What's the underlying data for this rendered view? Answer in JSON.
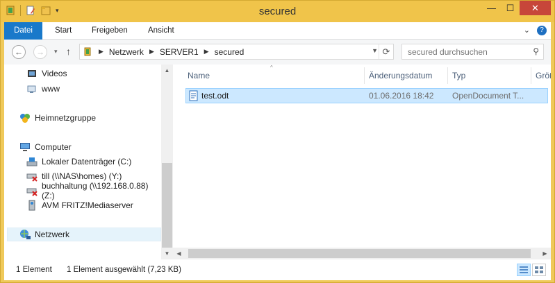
{
  "window": {
    "title": "secured",
    "accent": "#1979ca",
    "frame_color": "#f0c44a"
  },
  "window_controls": {
    "minimize": "—",
    "maximize": "☐",
    "close": "✕"
  },
  "ribbon": {
    "tabs": [
      "Datei",
      "Start",
      "Freigeben",
      "Ansicht"
    ],
    "expand_glyph": "⌄",
    "help_glyph": "?"
  },
  "navigation": {
    "back_glyph": "←",
    "forward_glyph": "→",
    "up_glyph": "↑",
    "recent_glyph": "▾",
    "breadcrumb": [
      "Netzwerk",
      "SERVER1",
      "secured"
    ],
    "refresh_glyph": "⟳",
    "search_placeholder": "secured durchsuchen"
  },
  "nav_pane": {
    "items": [
      {
        "label": "Videos",
        "icon": "video-icon"
      },
      {
        "label": "www",
        "icon": "network-folder-icon"
      },
      {
        "label": "Heimnetzgruppe",
        "icon": "homegroup-icon"
      },
      {
        "label": "Computer",
        "icon": "computer-icon"
      },
      {
        "label": "Lokaler Datenträger (C:)",
        "icon": "drive-icon"
      },
      {
        "label": "till (\\\\NAS\\homes) (Y:)",
        "icon": "disconnected-drive-icon"
      },
      {
        "label": "buchhaltung (\\\\192.168.0.88) (Z:)",
        "icon": "disconnected-drive-icon"
      },
      {
        "label": "AVM FRITZ!Mediaserver",
        "icon": "media-server-icon"
      },
      {
        "label": "Netzwerk",
        "icon": "network-icon"
      }
    ]
  },
  "file_list": {
    "columns": [
      "Name",
      "Änderungsdatum",
      "Typ",
      "Größe"
    ],
    "rows": [
      {
        "name": "test.odt",
        "date": "01.06.2016 18:42",
        "type": "OpenDocument T..."
      }
    ]
  },
  "status_bar": {
    "count": "1 Element",
    "selection": "1 Element ausgewählt (7,23 KB)"
  }
}
